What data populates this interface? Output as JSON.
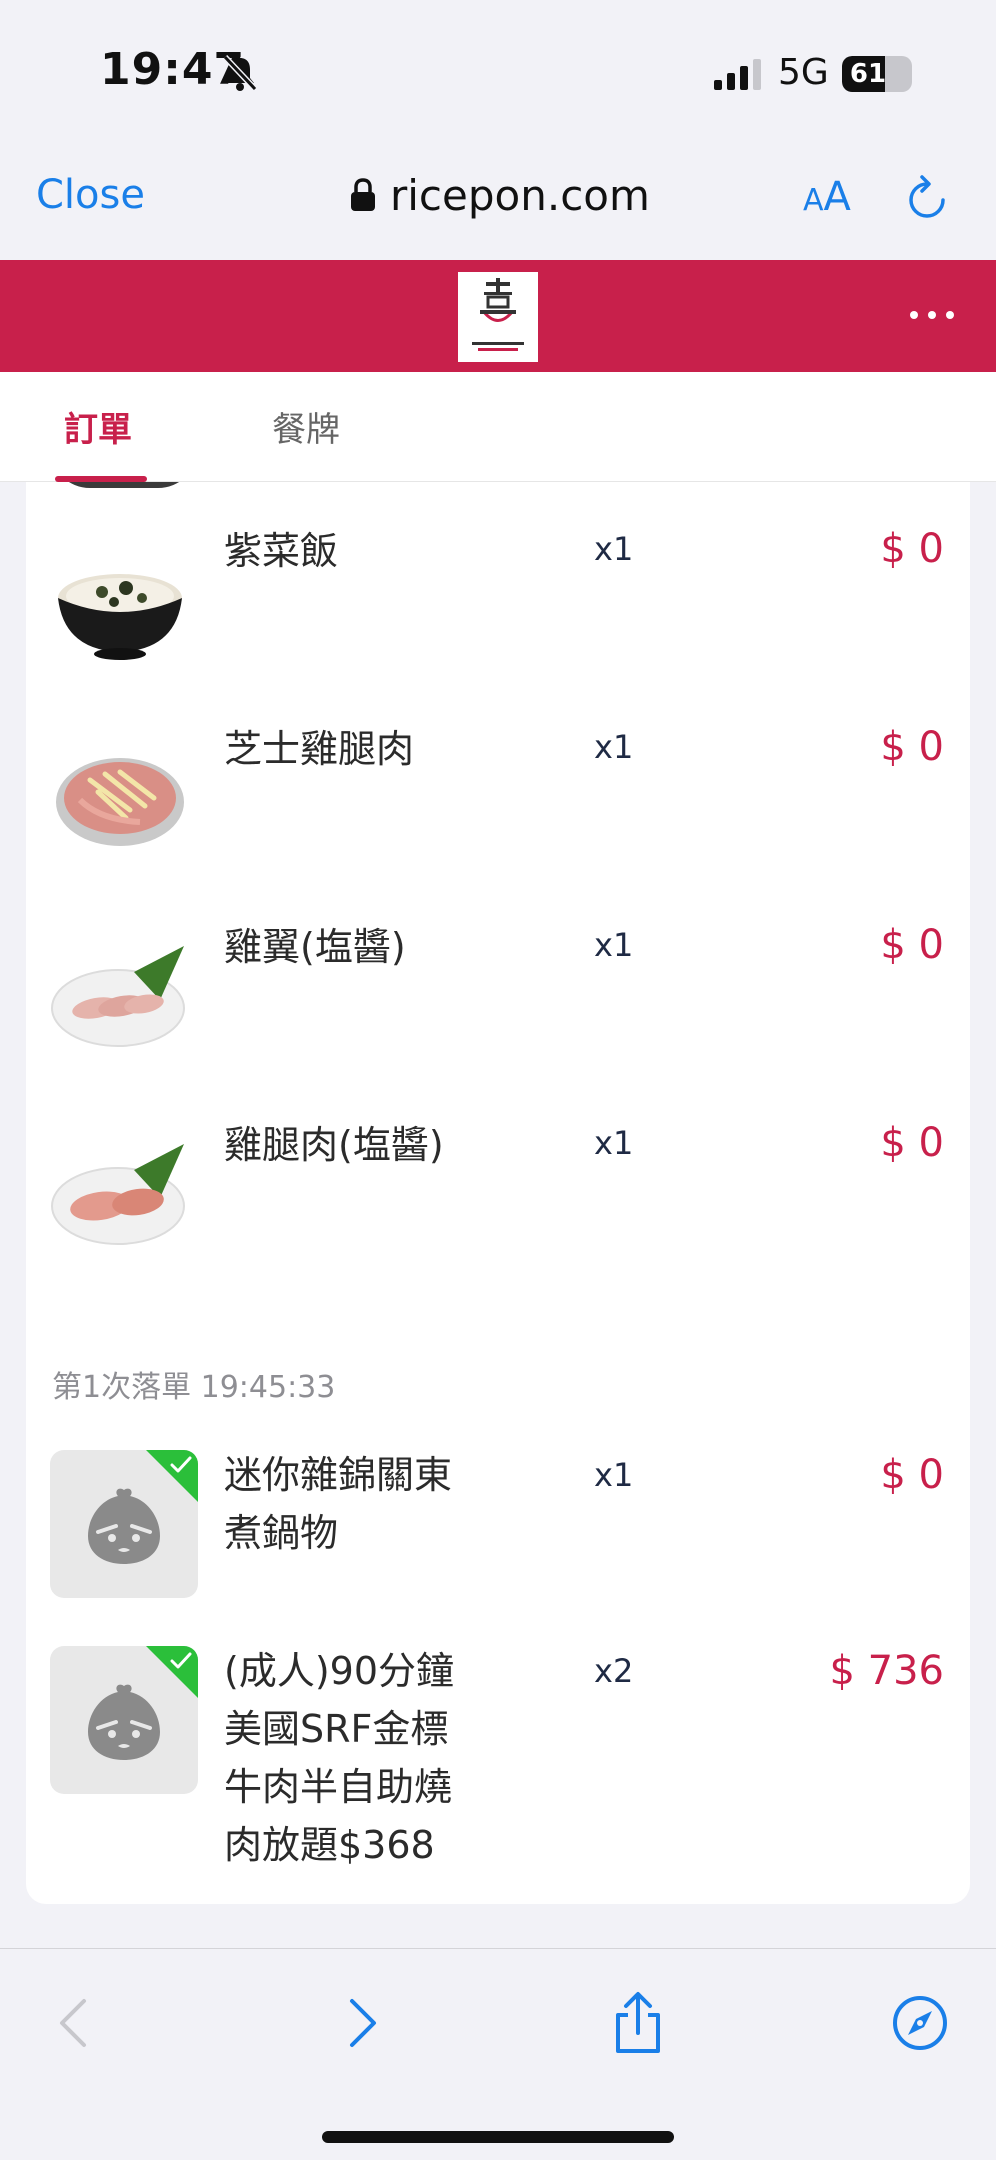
{
  "status": {
    "time": "19:47",
    "network": "5G",
    "battery": "61",
    "battery_level": 0.61
  },
  "browser": {
    "close_label": "Close",
    "url": "ricepon.com",
    "aa_small": "A",
    "aa_big": "A"
  },
  "tabs": {
    "orders": "訂單",
    "number": "餐牌"
  },
  "order_items": [
    {
      "name": "紫菜飯",
      "qty": "x1",
      "price": "$ 0",
      "icon": "seaweed-rice-photo"
    },
    {
      "name": "芝士雞腿肉",
      "qty": "x1",
      "price": "$ 0",
      "icon": "cheese-chicken-photo"
    },
    {
      "name": "雞翼(塩醬)",
      "qty": "x1",
      "price": "$ 0",
      "icon": "chicken-wing-photo"
    },
    {
      "name": "雞腿肉(塩醬)",
      "qty": "x1",
      "price": "$ 0",
      "icon": "chicken-thigh-photo"
    }
  ],
  "batch": {
    "label": "第1次落單 19:45:33",
    "items": [
      {
        "name_line1": "迷你雜錦關東",
        "name_line2": "煮鍋物",
        "qty": "x1",
        "price": "$ 0"
      },
      {
        "name_line1": "(成人)90分鐘",
        "name_line2": "美國SRF金標",
        "name_line3": "牛肉半自助燒",
        "name_line4": "肉放題$368",
        "qty": "x2",
        "price": "$ 736"
      }
    ]
  },
  "colors": {
    "brand": "#c8204b",
    "link": "#1a7fe8",
    "check": "#2bbf3a"
  }
}
